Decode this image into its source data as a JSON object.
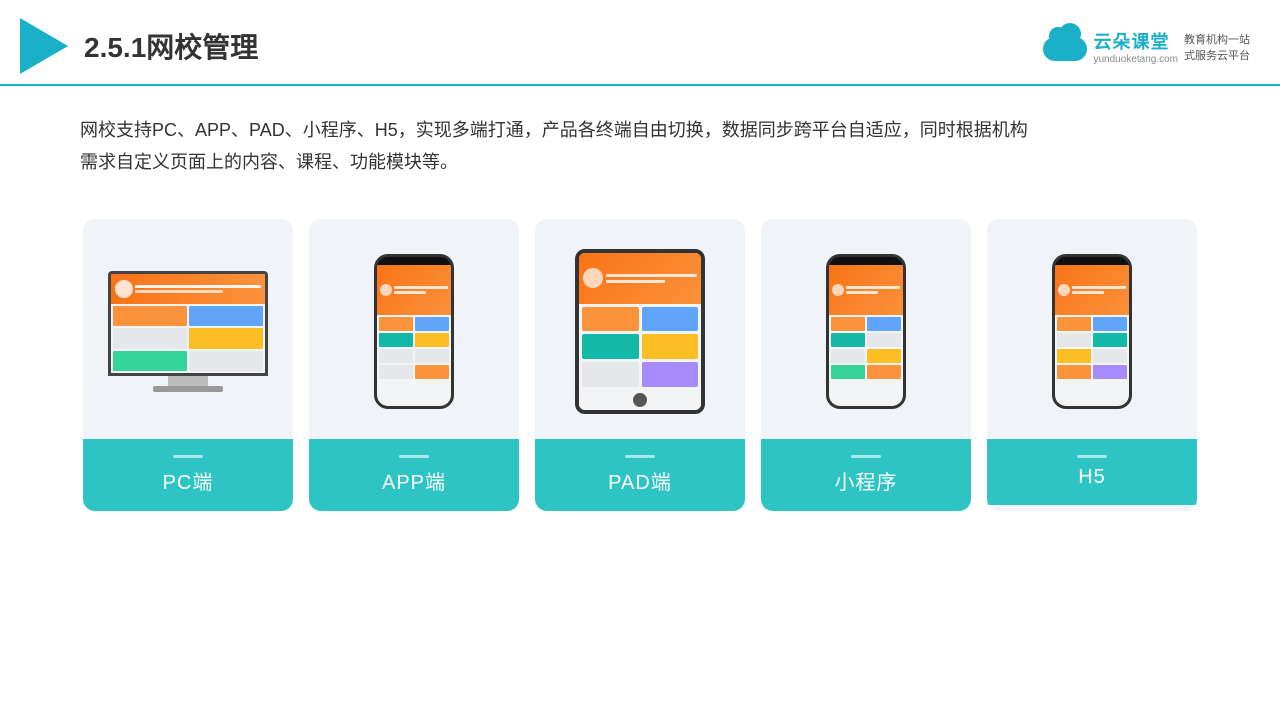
{
  "header": {
    "title": "2.5.1网校管理",
    "brand": {
      "name": "云朵课堂",
      "url": "yunduoketang.com",
      "tagline": "教育机构一站\n式服务云平台"
    }
  },
  "description": "网校支持PC、APP、PAD、小程序、H5，实现多端打通，产品各终端自由切换，数据同步跨平台自适应，同时根据机构\n需求自定义页面上的内容、课程、功能模块等。",
  "cards": [
    {
      "id": "pc",
      "label": "PC端"
    },
    {
      "id": "app",
      "label": "APP端"
    },
    {
      "id": "pad",
      "label": "PAD端"
    },
    {
      "id": "mini",
      "label": "小程序"
    },
    {
      "id": "h5",
      "label": "H5"
    }
  ],
  "accent_color": "#2ec4c4"
}
